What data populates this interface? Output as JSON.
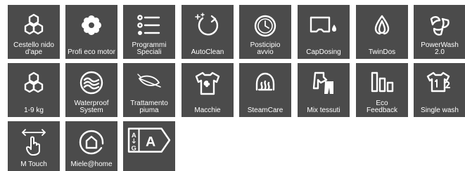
{
  "accent_color": "#4b4b4b",
  "features": [
    {
      "label": "Cestello nido\nd'ape",
      "icon": "honeycomb-drum-icon"
    },
    {
      "label": "Profi eco motor",
      "icon": "gear-motor-icon"
    },
    {
      "label": "Programmi\nSpeciali",
      "icon": "program-list-icon"
    },
    {
      "label": "AutoClean",
      "icon": "autoclean-icon"
    },
    {
      "label": "Posticipio\navvio",
      "icon": "delay-start-clock-icon"
    },
    {
      "label": "CapDosing",
      "icon": "capdosing-icon"
    },
    {
      "label": "TwinDos",
      "icon": "twindos-icon"
    },
    {
      "label": "PowerWash\n2.0",
      "icon": "powerwash-icon"
    },
    {
      "label": "1-9 kg",
      "icon": "load-capacity-icon"
    },
    {
      "label": "Waterproof\nSystem",
      "icon": "waterproof-icon"
    },
    {
      "label": "Trattamento\npiuma",
      "icon": "feather-icon"
    },
    {
      "label": "Macchie",
      "icon": "stain-shirt-icon"
    },
    {
      "label": "SteamCare",
      "icon": "steam-shirt-icon"
    },
    {
      "label": "Mix tessuti",
      "icon": "mixed-fabrics-icon"
    },
    {
      "label": "Eco\nFeedback",
      "icon": "eco-feedback-icon"
    },
    {
      "label": "Single wash",
      "icon": "single-wash-icon"
    },
    {
      "label": "M Touch",
      "icon": "touch-swipe-icon"
    },
    {
      "label": "Miele@home",
      "icon": "miele-home-icon"
    },
    {
      "label": "",
      "icon": "energy-label-icon",
      "energy_top": "A",
      "energy_bottom": "G",
      "energy_class": "A"
    }
  ]
}
